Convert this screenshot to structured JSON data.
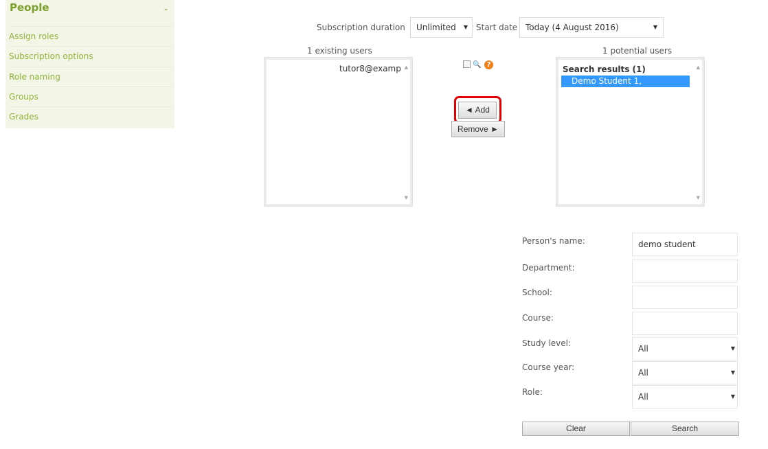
{
  "sidebar": {
    "title": "People",
    "collapse": "-",
    "items": [
      "Assign roles",
      "Subscription options",
      "Role naming",
      "Groups",
      "Grades"
    ]
  },
  "subscription": {
    "duration_label": "Subscription duration",
    "duration_value": "Unlimited",
    "start_label": "Start date",
    "start_value": "Today (4 August 2016)"
  },
  "existing": {
    "header": "1 existing users",
    "items": [
      "tutor8@examp"
    ]
  },
  "potential": {
    "header": "1 potential users",
    "group": "Search results (1)",
    "items": [
      "Demo Student 1,"
    ]
  },
  "actions": {
    "add": "◄ Add",
    "remove": "Remove ►"
  },
  "search_form": {
    "name_label": "Person's name:",
    "name_value": "demo student",
    "department_label": "Department:",
    "department_value": "",
    "school_label": "School:",
    "school_value": "",
    "course_label": "Course:",
    "course_value": "",
    "study_level_label": "Study level:",
    "study_level_value": "All",
    "course_year_label": "Course year:",
    "course_year_value": "All",
    "role_label": "Role:",
    "role_value": "All",
    "clear": "Clear",
    "search": "Search"
  },
  "colors": {
    "accent": "#7aa02c",
    "highlight": "#d00000",
    "selection": "#3399ff"
  }
}
